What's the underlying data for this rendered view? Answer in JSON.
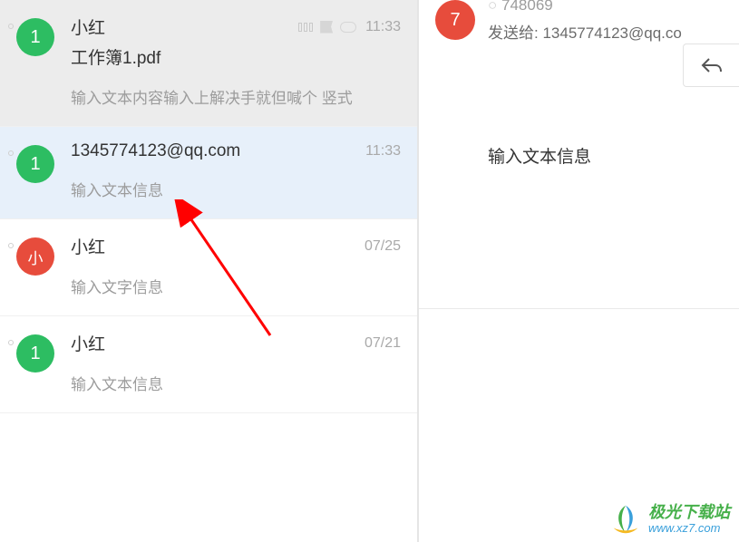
{
  "mail_list": [
    {
      "avatar_text": "1",
      "avatar_color": "green",
      "sender": "小红",
      "attachment": "工作簿1.pdf",
      "preview": "输入文本内容输入上解决手就但喊个  竖式",
      "time": "11:33",
      "highlight": "highlight1",
      "show_icons": true
    },
    {
      "avatar_text": "1",
      "avatar_color": "green",
      "sender": "1345774123@qq.com",
      "attachment": "",
      "preview": "输入文本信息",
      "time": "11:33",
      "highlight": "highlight2",
      "show_icons": false
    },
    {
      "avatar_text": "小",
      "avatar_color": "red",
      "sender": "小红",
      "attachment": "",
      "preview": "输入文字信息",
      "time": "07/25",
      "highlight": "",
      "show_icons": false
    },
    {
      "avatar_text": "1",
      "avatar_color": "green",
      "sender": "小红",
      "attachment": "",
      "preview": "输入文本信息",
      "time": "07/21",
      "highlight": "",
      "show_icons": false
    }
  ],
  "right_pane": {
    "header_avatar": "7",
    "header_partial": "748069",
    "send_to_label": "发送给:",
    "send_to_value": "1345774123@qq.co",
    "content": "输入文本信息"
  },
  "watermark": {
    "title": "极光下载站",
    "url": "www.xz7.com"
  }
}
